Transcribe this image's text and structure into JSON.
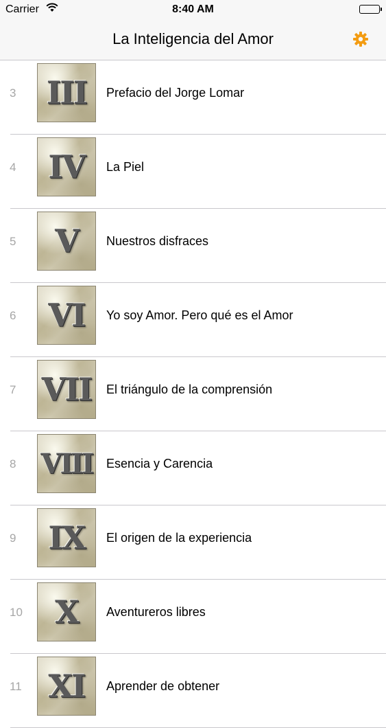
{
  "status_bar": {
    "carrier": "Carrier",
    "time": "8:40 AM"
  },
  "nav": {
    "title": "La Inteligencia del Amor",
    "settings_icon": "gear-icon",
    "accent_color": "#f39c12"
  },
  "items": [
    {
      "number": "3",
      "numeral": "III",
      "title": "Prefacio del Jorge Lomar"
    },
    {
      "number": "4",
      "numeral": "IV",
      "title": "La Piel"
    },
    {
      "number": "5",
      "numeral": "V",
      "title": "Nuestros disfraces"
    },
    {
      "number": "6",
      "numeral": "VI",
      "title": "Yo soy Amor. Pero qué es el Amor"
    },
    {
      "number": "7",
      "numeral": "VII",
      "title": "El triángulo de la comprensión"
    },
    {
      "number": "8",
      "numeral": "VIII",
      "title": "Esencia y Carencia"
    },
    {
      "number": "9",
      "numeral": "IX",
      "title": "El origen de la experiencia"
    },
    {
      "number": "10",
      "numeral": "X",
      "title": "Aventureros libres"
    },
    {
      "number": "11",
      "numeral": "XI",
      "title": "Aprender de obtener"
    }
  ]
}
